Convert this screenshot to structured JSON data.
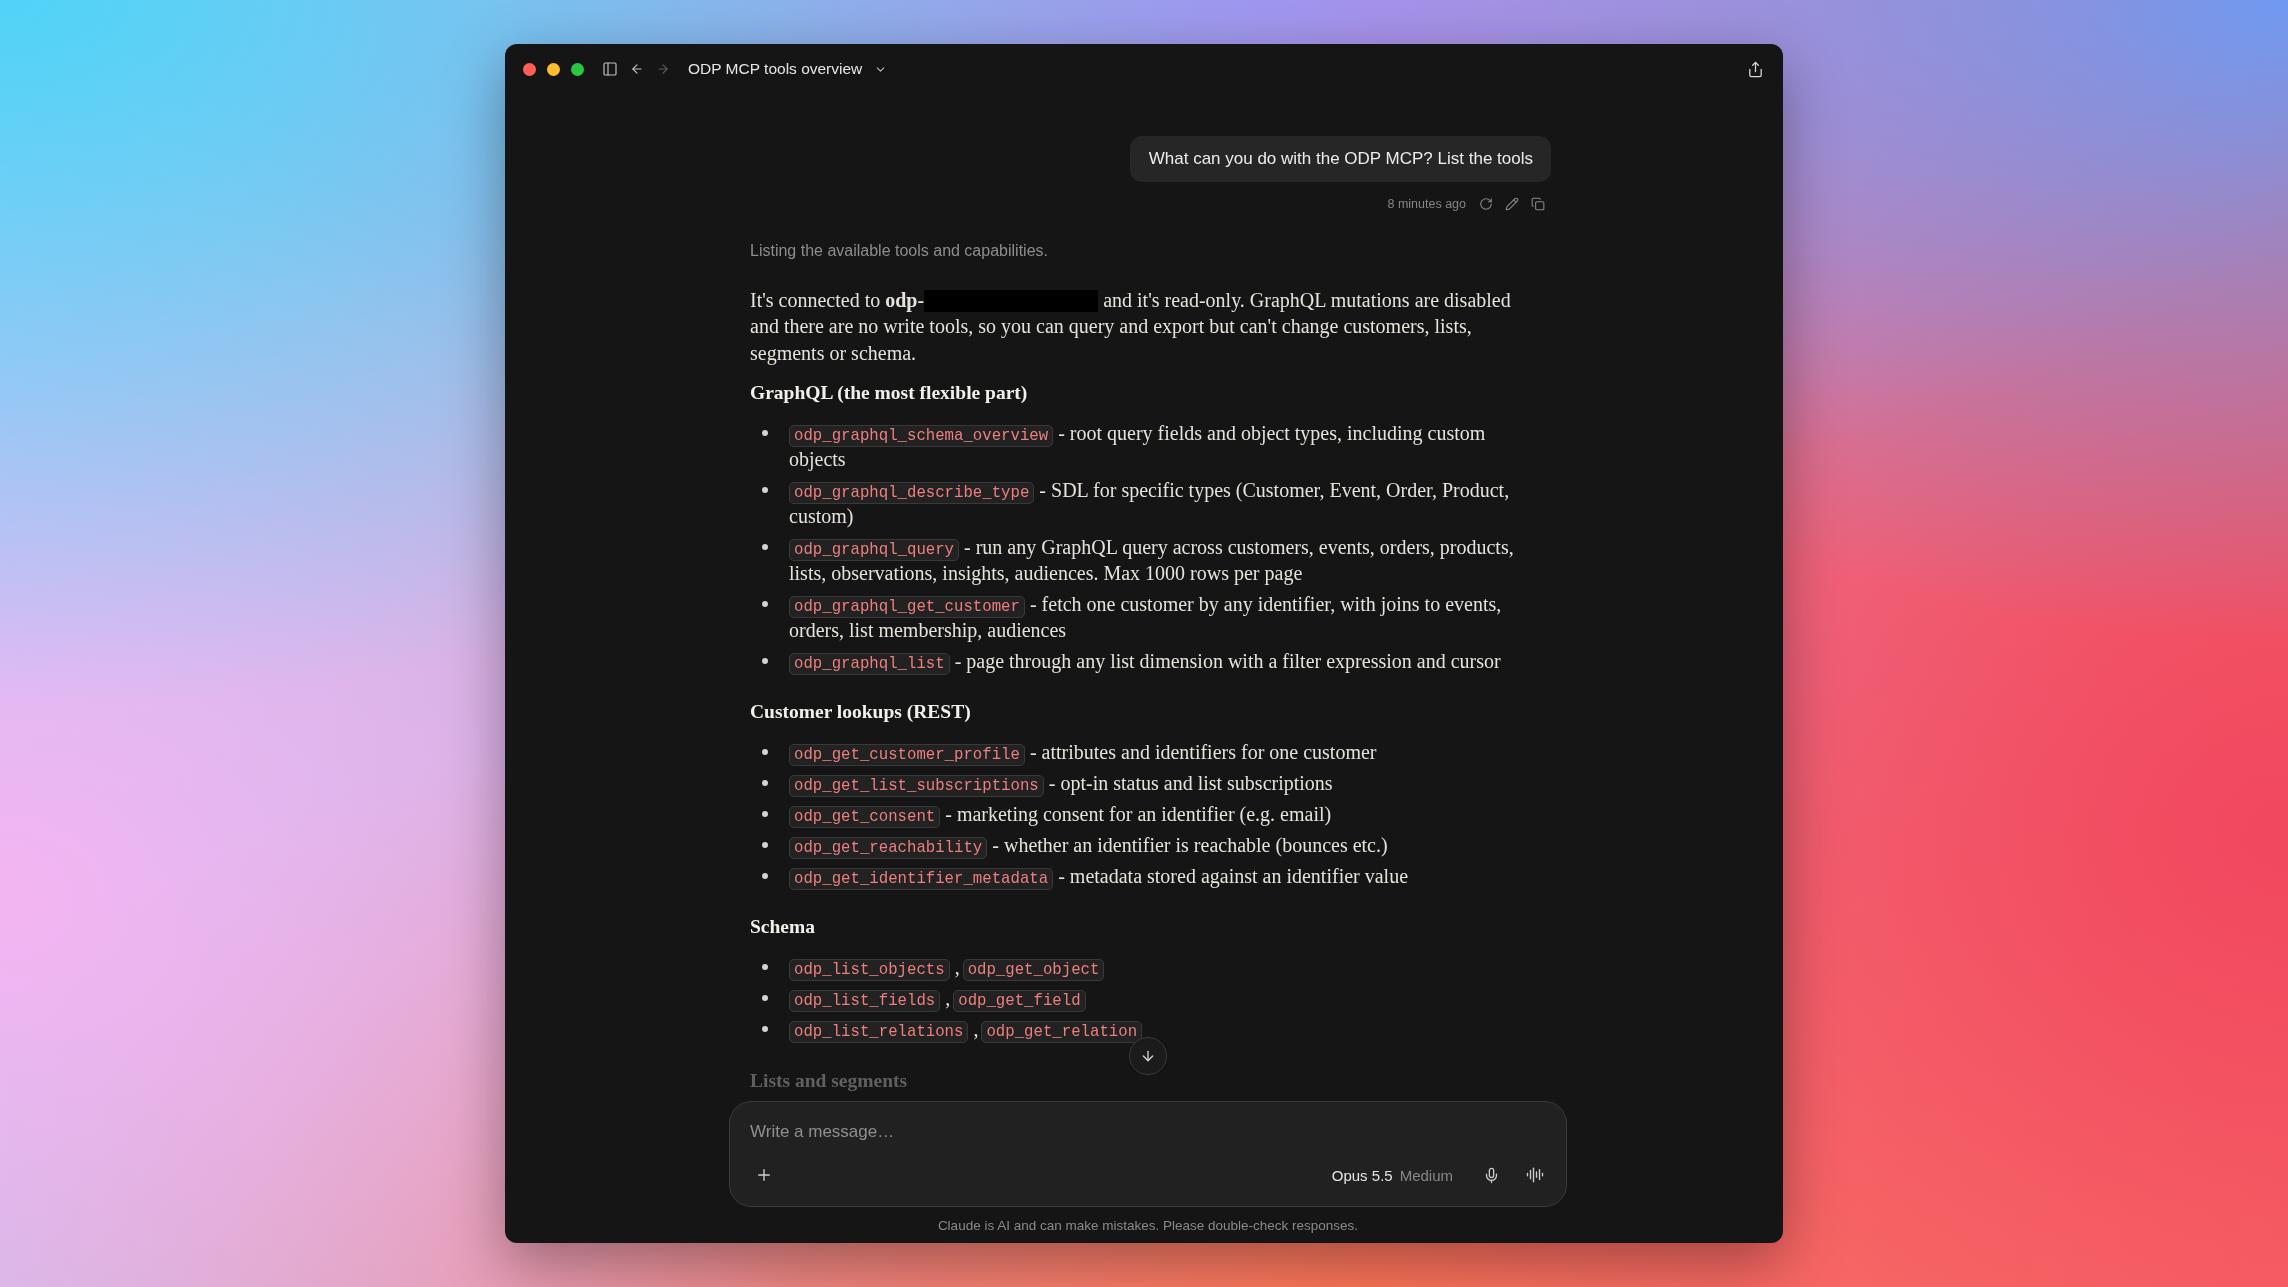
{
  "window": {
    "title": "ODP MCP tools overview"
  },
  "navigation": {
    "back_disabled": false,
    "forward_disabled": true
  },
  "user_message": {
    "text": "What can you do with the ODP MCP? List the tools",
    "time": "8 minutes ago"
  },
  "response": {
    "status": "Listing the available tools and capabilities.",
    "intro": [
      {
        "kind": "text",
        "text": "It's connected to **odp-**"
      },
      {
        "kind": "redaction"
      },
      {
        "kind": "text",
        "text": "and it's read-only. GraphQL mutations are disabled and there are no write tools, so you can query and export but can't change customers, lists, segments or schema."
      }
    ],
    "sections": [
      {
        "heading": "GraphQL (the most flexible part)",
        "items": [
          {
            "parts": [
              {
                "kind": "code",
                "text": "odp_graphql_schema_overview"
              },
              {
                "kind": "text",
                "text": "- root query fields and object types, including custom objects"
              }
            ]
          },
          {
            "parts": [
              {
                "kind": "code",
                "text": "odp_graphql_describe_type"
              },
              {
                "kind": "text",
                "text": "- SDL for specific types (Customer, Event, Order, Product, custom)"
              }
            ]
          },
          {
            "parts": [
              {
                "kind": "code",
                "text": "odp_graphql_query"
              },
              {
                "kind": "text",
                "text": "- run any GraphQL query across customers, events, orders, products, lists, observations, insights, audiences. Max 1000 rows per page"
              }
            ]
          },
          {
            "parts": [
              {
                "kind": "code",
                "text": "odp_graphql_get_customer"
              },
              {
                "kind": "text",
                "text": "- fetch one customer by any identifier, with joins to events, orders, list membership, audiences"
              }
            ]
          },
          {
            "parts": [
              {
                "kind": "code",
                "text": "odp_graphql_list"
              },
              {
                "kind": "text",
                "text": "- page through any list dimension with a filter expression and cursor"
              }
            ]
          }
        ]
      },
      {
        "heading": "Customer lookups (REST)",
        "items": [
          {
            "parts": [
              {
                "kind": "code",
                "text": "odp_get_customer_profile"
              },
              {
                "kind": "text",
                "text": "- attributes and identifiers for one customer"
              }
            ]
          },
          {
            "parts": [
              {
                "kind": "code",
                "text": "odp_get_list_subscriptions"
              },
              {
                "kind": "text",
                "text": "- opt-in status and list subscriptions"
              }
            ]
          },
          {
            "parts": [
              {
                "kind": "code",
                "text": "odp_get_consent"
              },
              {
                "kind": "text",
                "text": "- marketing consent for an identifier (e.g. email)"
              }
            ]
          },
          {
            "parts": [
              {
                "kind": "code",
                "text": "odp_get_reachability"
              },
              {
                "kind": "text",
                "text": "- whether an identifier is reachable (bounces etc.)"
              }
            ]
          },
          {
            "parts": [
              {
                "kind": "code",
                "text": "odp_get_identifier_metadata"
              },
              {
                "kind": "text",
                "text": "- metadata stored against an identifier value"
              }
            ]
          }
        ]
      },
      {
        "heading": "Schema",
        "items": [
          {
            "parts": [
              {
                "kind": "code",
                "text": "odp_list_objects"
              },
              {
                "kind": "text",
                "text": ","
              },
              {
                "kind": "code",
                "text": "odp_get_object"
              }
            ]
          },
          {
            "parts": [
              {
                "kind": "code",
                "text": "odp_list_fields"
              },
              {
                "kind": "text",
                "text": ","
              },
              {
                "kind": "code",
                "text": "odp_get_field"
              }
            ]
          },
          {
            "parts": [
              {
                "kind": "code",
                "text": "odp_list_relations"
              },
              {
                "kind": "text",
                "text": ","
              },
              {
                "kind": "code",
                "text": "odp_get_relation"
              }
            ]
          }
        ]
      }
    ],
    "next_heading": "Lists and segments"
  },
  "composer": {
    "placeholder": "Write a message…",
    "model": "Opus 5.5",
    "effort": "Medium"
  },
  "disclaimer": "Claude is AI and can make mistakes. Please double-check responses."
}
